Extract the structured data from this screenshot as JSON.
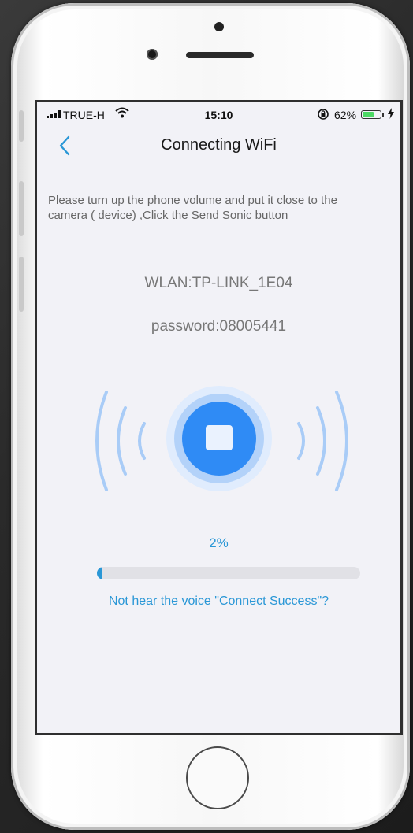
{
  "status_bar": {
    "carrier": "TRUE-H",
    "time": "15:10",
    "battery_percent": "62%",
    "battery_level": 0.62,
    "icons": [
      "signal-icon",
      "wifi-icon",
      "orientation-lock-icon",
      "battery-icon",
      "charging-icon"
    ]
  },
  "nav": {
    "title": "Connecting WiFi",
    "back_icon": "chevron-left-icon"
  },
  "content": {
    "instructions": " Please turn up the phone volume and put it close to the camera ( device) ,Click the Send Sonic button",
    "wlan": "WLAN:TP-LINK_1E04",
    "password": "password:08005441"
  },
  "sonic_button": {
    "icon": "stop-icon"
  },
  "progress": {
    "label": "2%",
    "value": 0.02
  },
  "help_link": "Not hear the voice \"Connect Success\"?",
  "colors": {
    "accent": "#2a97d6",
    "button_core": "#2f8bf5",
    "sound_waves": "#a9ccf7",
    "background": "#f2f2f7"
  }
}
